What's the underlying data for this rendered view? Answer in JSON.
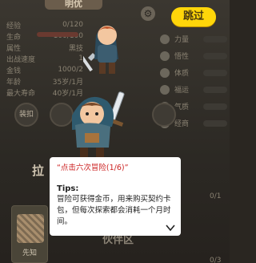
{
  "top_tab": "明优",
  "skip_button": "跳过",
  "stats_left": [
    {
      "label": "经验",
      "value": "0/120"
    },
    {
      "label": "生命",
      "value": "100/100"
    },
    {
      "label": "属性",
      "value": "黑技"
    },
    {
      "label": "出战速度",
      "value": "1"
    },
    {
      "label": "金钱",
      "value": "1000/2"
    },
    {
      "label": "年龄",
      "value": "35岁/1月"
    },
    {
      "label": "最大寿命",
      "value": "40岁/1月"
    }
  ],
  "stats_right": [
    {
      "label": "力量"
    },
    {
      "label": "悟性"
    },
    {
      "label": "体质"
    },
    {
      "label": "福运"
    },
    {
      "label": "气质"
    },
    {
      "label": "经商"
    }
  ],
  "round_button_label": "装扣",
  "section_heading": "拉",
  "section_heading_2": "伙伴区",
  "counts": [
    "0/1",
    "0/3"
  ],
  "card_label": "先知",
  "dialog": {
    "title": "“点击六次冒险(1/6)”",
    "tips_title": "Tips:",
    "tips_body": "冒险可获得金币，用来购买契约卡包，但每次探索都会消耗一个月时间。"
  },
  "colors": {
    "accent": "#ffd60a",
    "dialog_title": "#cc2222"
  }
}
